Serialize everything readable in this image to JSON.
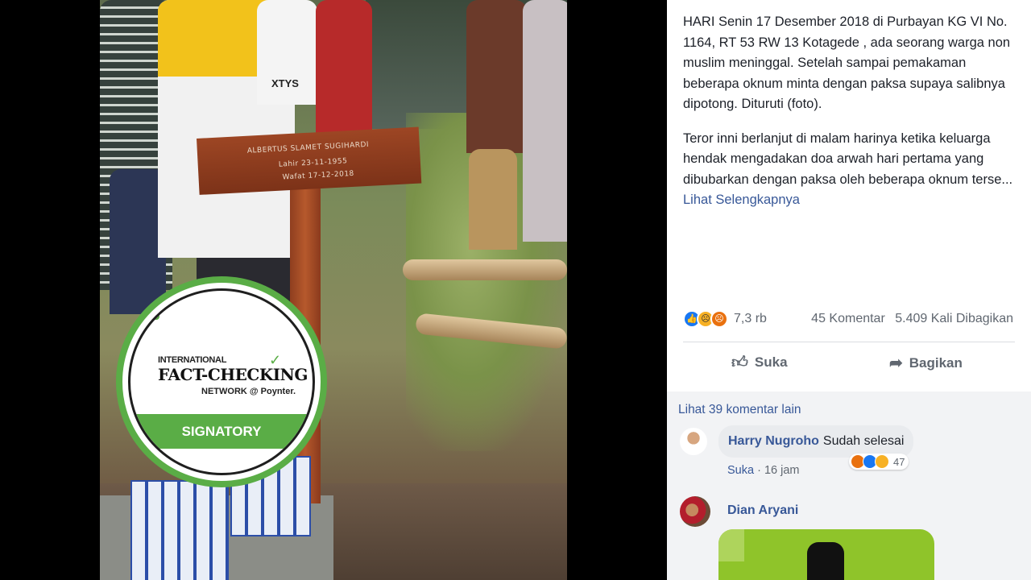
{
  "photo": {
    "cross_name": "ALBERTUS SLAMET SUGIHARDI",
    "cross_born": "Lahir 23-11-1955",
    "cross_died": "Wafat 17-12-2018",
    "shirt_text": "XTYS"
  },
  "badge": {
    "line1": "INTERNATIONAL",
    "line2": "FACT-CHECKING",
    "line3": "NETWORK @ Poynter.",
    "band": "SIGNATORY",
    "accent": "#5aad46"
  },
  "post": {
    "paragraph1": "HARI Senin 17 Desember 2018 di Purbayan KG VI No. 1164, RT 53 RW 13 Kotagede , ada seorang warga non muslim meninggal. Setelah sampai pemakaman beberapa oknum minta dengan paksa supaya salibnya dipotong. Dituruti (foto).",
    "paragraph2": "Teror inni berlanjut di malam harinya ketika keluarga hendak mengadakan doa arwah hari pertama yang dibubarkan dengan paksa oleh beberapa oknum terse...",
    "see_more": "Lihat Selengkapnya",
    "reaction_icons": [
      "like-icon",
      "sad-icon",
      "angry-icon"
    ],
    "reaction_count": "7,3 rb",
    "comments_count": "45 Komentar",
    "shares_count": "5.409 Kali Dibagikan",
    "like_label": "Suka",
    "share_label": "Bagikan",
    "link_color": "#385898"
  },
  "comments": {
    "see_more": "Lihat 39 komentar lain",
    "items": [
      {
        "name": "Harry Nugroho",
        "text": "Sudah selesai",
        "reaction_count": "47",
        "like_label": "Suka",
        "time": "16 jam"
      },
      {
        "name": "Dian Aryani"
      }
    ]
  }
}
